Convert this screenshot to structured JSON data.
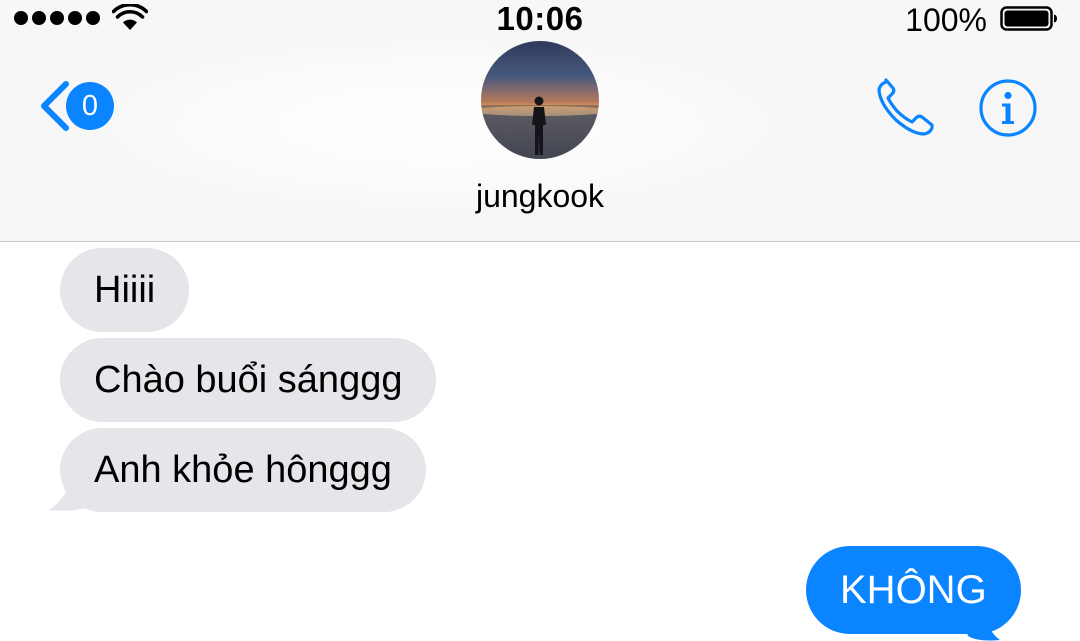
{
  "status_bar": {
    "signal_dots": 5,
    "time": "10:06",
    "battery_percent": "100%",
    "icons": [
      "signal-dots-icon",
      "wifi-icon",
      "battery-icon"
    ]
  },
  "nav": {
    "back_badge": "0",
    "contact_name": "jungkook",
    "icons": [
      "back-chevron-icon",
      "phone-icon",
      "info-icon"
    ],
    "accent_color": "#0a84ff"
  },
  "messages": [
    {
      "direction": "incoming",
      "text": "Hiiii"
    },
    {
      "direction": "incoming",
      "text": "Chào buổi sánggg"
    },
    {
      "direction": "incoming",
      "text": "Anh khỏe hônggg"
    },
    {
      "direction": "outgoing",
      "text": "KHÔNG"
    }
  ],
  "colors": {
    "incoming_bubble": "#e5e5ea",
    "outgoing_bubble": "#0a84ff",
    "header_background": "#f7f7f7"
  }
}
